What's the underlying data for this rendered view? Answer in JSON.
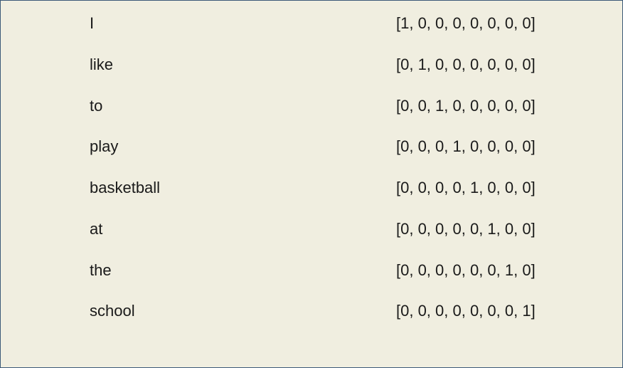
{
  "rows": [
    {
      "word": "I",
      "vector": "[1, 0, 0, 0, 0, 0, 0, 0]"
    },
    {
      "word": "like",
      "vector": "[0, 1, 0, 0, 0, 0, 0, 0]"
    },
    {
      "word": "to",
      "vector": "[0, 0, 1, 0, 0, 0, 0, 0]"
    },
    {
      "word": "play",
      "vector": "[0, 0, 0, 1, 0, 0, 0, 0]"
    },
    {
      "word": "basketball",
      "vector": "[0, 0, 0, 0, 1, 0, 0, 0]"
    },
    {
      "word": "at",
      "vector": "[0, 0, 0, 0, 0, 1, 0, 0]"
    },
    {
      "word": "the",
      "vector": "[0, 0, 0, 0, 0, 0, 1, 0]"
    },
    {
      "word": "school",
      "vector": "[0, 0, 0, 0, 0, 0, 0, 1]"
    }
  ]
}
